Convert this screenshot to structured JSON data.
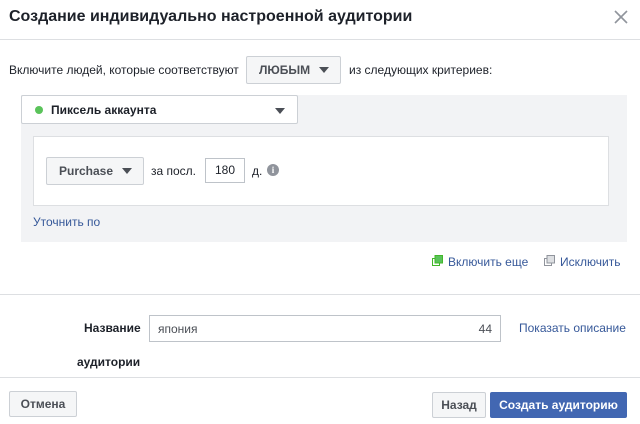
{
  "dialog": {
    "title": "Создание индивидуально настроенной аудитории"
  },
  "include_row": {
    "prefix": "Включите людей, которые соответствуют",
    "match_value": "ЛЮБЫМ",
    "suffix": "из следующих критериев:"
  },
  "source": {
    "selected": "Пиксель аккаунта",
    "status_color": "#5ac35a"
  },
  "rule": {
    "event": "Purchase",
    "period_label": "за посл.",
    "days_value": "180",
    "days_unit": "д."
  },
  "refine_link": "Уточнить по",
  "actions": {
    "include_more": "Включить еще",
    "exclude": "Исключить"
  },
  "audience_name": {
    "label_line1": "Название",
    "label_line2": "аудитории",
    "value": "япония",
    "char_count": "44",
    "show_description": "Показать описание"
  },
  "footer": {
    "cancel": "Отмена",
    "back": "Назад",
    "create": "Создать аудиторию"
  },
  "colors": {
    "primary": "#4267b2",
    "link": "#365899",
    "panel": "#f2f3f5"
  }
}
